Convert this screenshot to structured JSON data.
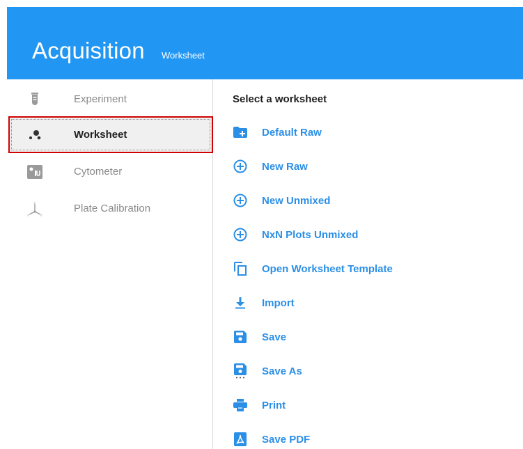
{
  "header": {
    "title": "Acquisition",
    "subtitle": "Worksheet"
  },
  "colors": {
    "accent": "#2196f3",
    "link": "#2b8fe6",
    "highlight_border": "#d00000"
  },
  "sidebar": {
    "items": [
      {
        "label": "Experiment",
        "icon": "test-tube-icon",
        "active": false
      },
      {
        "label": "Worksheet",
        "icon": "dots-icon",
        "active": true
      },
      {
        "label": "Cytometer",
        "icon": "cytometer-icon",
        "active": false
      },
      {
        "label": "Plate Calibration",
        "icon": "axes-icon",
        "active": false
      }
    ]
  },
  "main": {
    "heading": "Select a worksheet",
    "actions": [
      {
        "label": "Default Raw",
        "icon": "folder-plus-icon"
      },
      {
        "label": "New Raw",
        "icon": "circle-plus-icon"
      },
      {
        "label": "New Unmixed",
        "icon": "circle-plus-icon"
      },
      {
        "label": "NxN Plots Unmixed",
        "icon": "circle-plus-icon"
      },
      {
        "label": "Open Worksheet Template",
        "icon": "copy-icon"
      },
      {
        "label": "Import",
        "icon": "download-icon"
      },
      {
        "label": "Save",
        "icon": "floppy-icon"
      },
      {
        "label": "Save As",
        "icon": "floppy-dots-icon"
      },
      {
        "label": "Print",
        "icon": "printer-icon"
      },
      {
        "label": "Save PDF",
        "icon": "pdf-icon"
      }
    ]
  }
}
